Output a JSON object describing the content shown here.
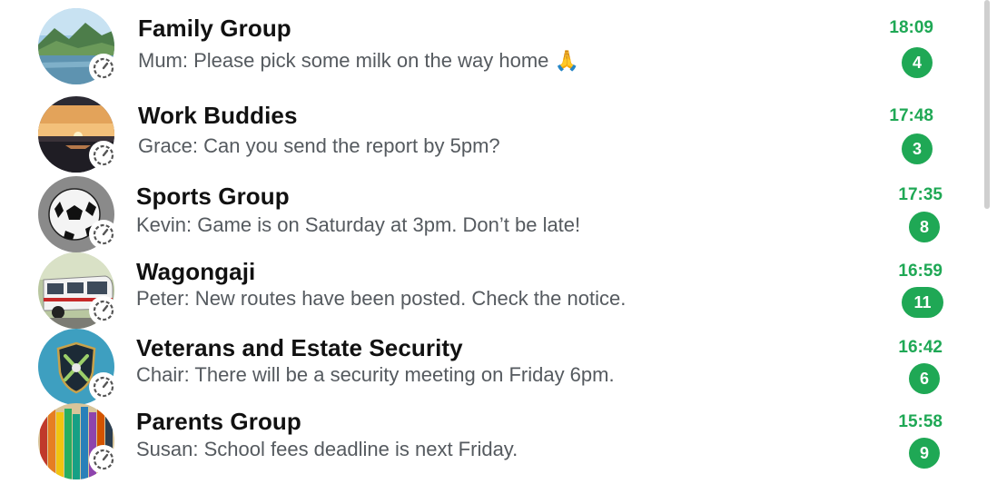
{
  "chats": [
    {
      "name": "Family Group",
      "preview": "Mum: Please pick some milk on the way home 🙏",
      "time": "18:09",
      "unread": "4",
      "avatar": "lake-mountain-avatar",
      "status_icon": "clock-status-icon"
    },
    {
      "name": "Work Buddies",
      "preview": "Grace: Can you send the report by 5pm?",
      "time": "17:48",
      "unread": "3",
      "avatar": "sunset-avatar",
      "status_icon": "clock-status-icon"
    },
    {
      "name": "Sports Group",
      "preview": "Kevin: Game is on Saturday at 3pm. Don’t be late!",
      "time": "17:35",
      "unread": "8",
      "avatar": "soccer-ball-avatar",
      "status_icon": "clock-status-icon"
    },
    {
      "name": "Wagongaji",
      "preview": "Peter: New routes have been posted. Check the notice.",
      "time": "16:59",
      "unread": "11",
      "avatar": "minibus-avatar",
      "status_icon": "clock-status-icon"
    },
    {
      "name": "Veterans and Estate Security",
      "preview": "Chair: There will be a security meeting on Friday 6pm.",
      "time": "16:42",
      "unread": "6",
      "avatar": "shield-avatar",
      "status_icon": "clock-status-icon"
    },
    {
      "name": "Parents Group",
      "preview": "Susan: School fees deadline is next Friday.",
      "time": "15:58",
      "unread": "9",
      "avatar": "pencils-avatar",
      "status_icon": "clock-status-icon"
    }
  ],
  "colors": {
    "accent": "#1fa855",
    "name": "#111111",
    "preview": "#555a5f"
  }
}
